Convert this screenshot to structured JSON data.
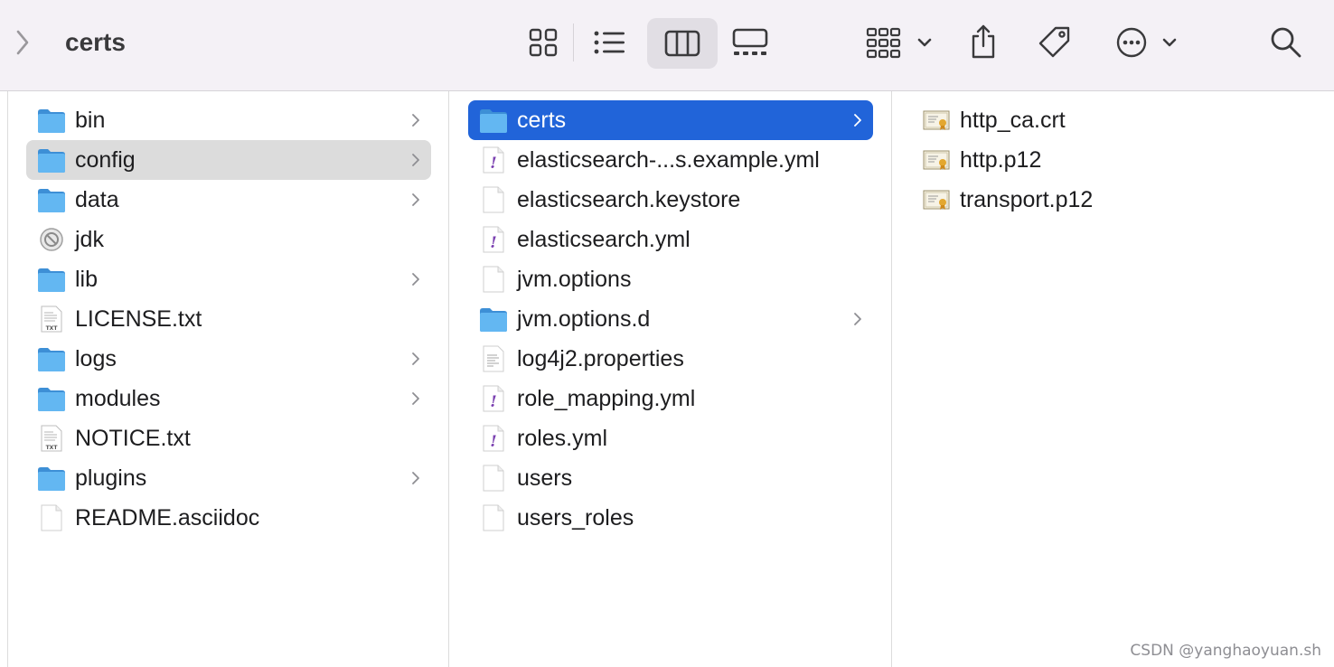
{
  "toolbar": {
    "title": "certs",
    "icons": [
      "chevron-right-icon",
      "icon-view-icon",
      "list-view-icon",
      "column-view-icon",
      "gallery-view-icon",
      "group-icon",
      "share-icon",
      "tag-icon",
      "more-icon",
      "search-icon"
    ]
  },
  "columns": [
    {
      "items": [
        {
          "name": "bin",
          "kind": "folder",
          "chevron": true
        },
        {
          "name": "config",
          "kind": "folder",
          "chevron": true,
          "selected": "gray"
        },
        {
          "name": "data",
          "kind": "folder",
          "chevron": true
        },
        {
          "name": "jdk",
          "kind": "restricted",
          "chevron": false
        },
        {
          "name": "lib",
          "kind": "folder",
          "chevron": true
        },
        {
          "name": "LICENSE.txt",
          "kind": "txt",
          "chevron": false
        },
        {
          "name": "logs",
          "kind": "folder",
          "chevron": true
        },
        {
          "name": "modules",
          "kind": "folder",
          "chevron": true
        },
        {
          "name": "NOTICE.txt",
          "kind": "txt",
          "chevron": false
        },
        {
          "name": "plugins",
          "kind": "folder",
          "chevron": true
        },
        {
          "name": "README.asciidoc",
          "kind": "blank",
          "chevron": false
        }
      ]
    },
    {
      "items": [
        {
          "name": "certs",
          "kind": "folder",
          "chevron": true,
          "selected": "blue"
        },
        {
          "name": "elasticsearch-...s.example.yml",
          "kind": "yml",
          "chevron": false
        },
        {
          "name": "elasticsearch.keystore",
          "kind": "blank",
          "chevron": false
        },
        {
          "name": "elasticsearch.yml",
          "kind": "yml",
          "chevron": false
        },
        {
          "name": "jvm.options",
          "kind": "blank",
          "chevron": false
        },
        {
          "name": "jvm.options.d",
          "kind": "folder",
          "chevron": true
        },
        {
          "name": "log4j2.properties",
          "kind": "text",
          "chevron": false
        },
        {
          "name": "role_mapping.yml",
          "kind": "yml",
          "chevron": false
        },
        {
          "name": "roles.yml",
          "kind": "yml",
          "chevron": false
        },
        {
          "name": "users",
          "kind": "blank",
          "chevron": false
        },
        {
          "name": "users_roles",
          "kind": "blank",
          "chevron": false
        }
      ]
    },
    {
      "items": [
        {
          "name": "http_ca.crt",
          "kind": "cert",
          "chevron": false
        },
        {
          "name": "http.p12",
          "kind": "cert",
          "chevron": false
        },
        {
          "name": "transport.p12",
          "kind": "cert",
          "chevron": false
        }
      ]
    }
  ],
  "watermark": "CSDN @yanghaoyuan.sh",
  "colors": {
    "selection_blue": "#2164d9",
    "selection_gray": "#dcdcdc",
    "folder_blue": "#5eb4f0",
    "toolbar_bg": "#f4f1f6"
  }
}
